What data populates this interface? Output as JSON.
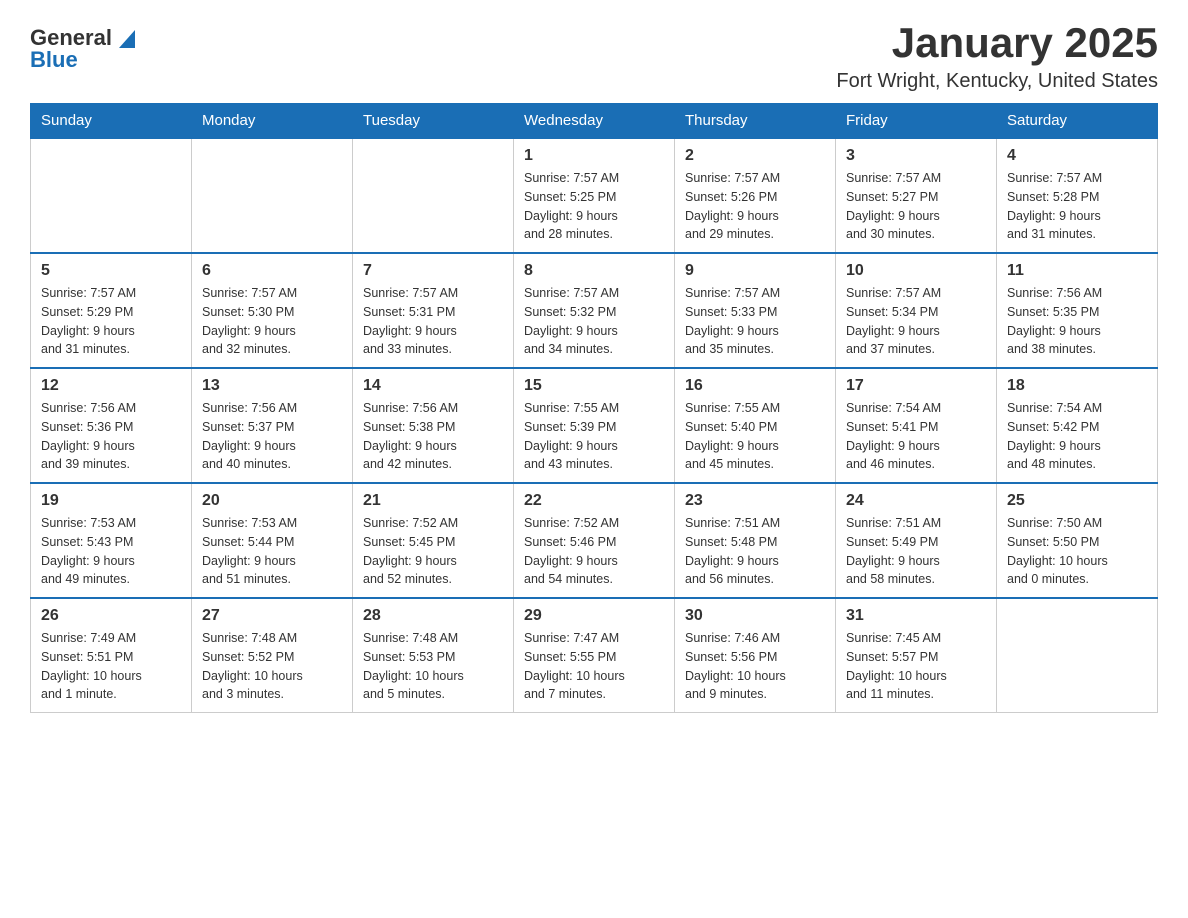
{
  "header": {
    "logo_general": "General",
    "logo_blue": "Blue",
    "title": "January 2025",
    "subtitle": "Fort Wright, Kentucky, United States"
  },
  "weekdays": [
    "Sunday",
    "Monday",
    "Tuesday",
    "Wednesday",
    "Thursday",
    "Friday",
    "Saturday"
  ],
  "weeks": [
    [
      {
        "day": "",
        "info": ""
      },
      {
        "day": "",
        "info": ""
      },
      {
        "day": "",
        "info": ""
      },
      {
        "day": "1",
        "info": "Sunrise: 7:57 AM\nSunset: 5:25 PM\nDaylight: 9 hours\nand 28 minutes."
      },
      {
        "day": "2",
        "info": "Sunrise: 7:57 AM\nSunset: 5:26 PM\nDaylight: 9 hours\nand 29 minutes."
      },
      {
        "day": "3",
        "info": "Sunrise: 7:57 AM\nSunset: 5:27 PM\nDaylight: 9 hours\nand 30 minutes."
      },
      {
        "day": "4",
        "info": "Sunrise: 7:57 AM\nSunset: 5:28 PM\nDaylight: 9 hours\nand 31 minutes."
      }
    ],
    [
      {
        "day": "5",
        "info": "Sunrise: 7:57 AM\nSunset: 5:29 PM\nDaylight: 9 hours\nand 31 minutes."
      },
      {
        "day": "6",
        "info": "Sunrise: 7:57 AM\nSunset: 5:30 PM\nDaylight: 9 hours\nand 32 minutes."
      },
      {
        "day": "7",
        "info": "Sunrise: 7:57 AM\nSunset: 5:31 PM\nDaylight: 9 hours\nand 33 minutes."
      },
      {
        "day": "8",
        "info": "Sunrise: 7:57 AM\nSunset: 5:32 PM\nDaylight: 9 hours\nand 34 minutes."
      },
      {
        "day": "9",
        "info": "Sunrise: 7:57 AM\nSunset: 5:33 PM\nDaylight: 9 hours\nand 35 minutes."
      },
      {
        "day": "10",
        "info": "Sunrise: 7:57 AM\nSunset: 5:34 PM\nDaylight: 9 hours\nand 37 minutes."
      },
      {
        "day": "11",
        "info": "Sunrise: 7:56 AM\nSunset: 5:35 PM\nDaylight: 9 hours\nand 38 minutes."
      }
    ],
    [
      {
        "day": "12",
        "info": "Sunrise: 7:56 AM\nSunset: 5:36 PM\nDaylight: 9 hours\nand 39 minutes."
      },
      {
        "day": "13",
        "info": "Sunrise: 7:56 AM\nSunset: 5:37 PM\nDaylight: 9 hours\nand 40 minutes."
      },
      {
        "day": "14",
        "info": "Sunrise: 7:56 AM\nSunset: 5:38 PM\nDaylight: 9 hours\nand 42 minutes."
      },
      {
        "day": "15",
        "info": "Sunrise: 7:55 AM\nSunset: 5:39 PM\nDaylight: 9 hours\nand 43 minutes."
      },
      {
        "day": "16",
        "info": "Sunrise: 7:55 AM\nSunset: 5:40 PM\nDaylight: 9 hours\nand 45 minutes."
      },
      {
        "day": "17",
        "info": "Sunrise: 7:54 AM\nSunset: 5:41 PM\nDaylight: 9 hours\nand 46 minutes."
      },
      {
        "day": "18",
        "info": "Sunrise: 7:54 AM\nSunset: 5:42 PM\nDaylight: 9 hours\nand 48 minutes."
      }
    ],
    [
      {
        "day": "19",
        "info": "Sunrise: 7:53 AM\nSunset: 5:43 PM\nDaylight: 9 hours\nand 49 minutes."
      },
      {
        "day": "20",
        "info": "Sunrise: 7:53 AM\nSunset: 5:44 PM\nDaylight: 9 hours\nand 51 minutes."
      },
      {
        "day": "21",
        "info": "Sunrise: 7:52 AM\nSunset: 5:45 PM\nDaylight: 9 hours\nand 52 minutes."
      },
      {
        "day": "22",
        "info": "Sunrise: 7:52 AM\nSunset: 5:46 PM\nDaylight: 9 hours\nand 54 minutes."
      },
      {
        "day": "23",
        "info": "Sunrise: 7:51 AM\nSunset: 5:48 PM\nDaylight: 9 hours\nand 56 minutes."
      },
      {
        "day": "24",
        "info": "Sunrise: 7:51 AM\nSunset: 5:49 PM\nDaylight: 9 hours\nand 58 minutes."
      },
      {
        "day": "25",
        "info": "Sunrise: 7:50 AM\nSunset: 5:50 PM\nDaylight: 10 hours\nand 0 minutes."
      }
    ],
    [
      {
        "day": "26",
        "info": "Sunrise: 7:49 AM\nSunset: 5:51 PM\nDaylight: 10 hours\nand 1 minute."
      },
      {
        "day": "27",
        "info": "Sunrise: 7:48 AM\nSunset: 5:52 PM\nDaylight: 10 hours\nand 3 minutes."
      },
      {
        "day": "28",
        "info": "Sunrise: 7:48 AM\nSunset: 5:53 PM\nDaylight: 10 hours\nand 5 minutes."
      },
      {
        "day": "29",
        "info": "Sunrise: 7:47 AM\nSunset: 5:55 PM\nDaylight: 10 hours\nand 7 minutes."
      },
      {
        "day": "30",
        "info": "Sunrise: 7:46 AM\nSunset: 5:56 PM\nDaylight: 10 hours\nand 9 minutes."
      },
      {
        "day": "31",
        "info": "Sunrise: 7:45 AM\nSunset: 5:57 PM\nDaylight: 10 hours\nand 11 minutes."
      },
      {
        "day": "",
        "info": ""
      }
    ]
  ]
}
